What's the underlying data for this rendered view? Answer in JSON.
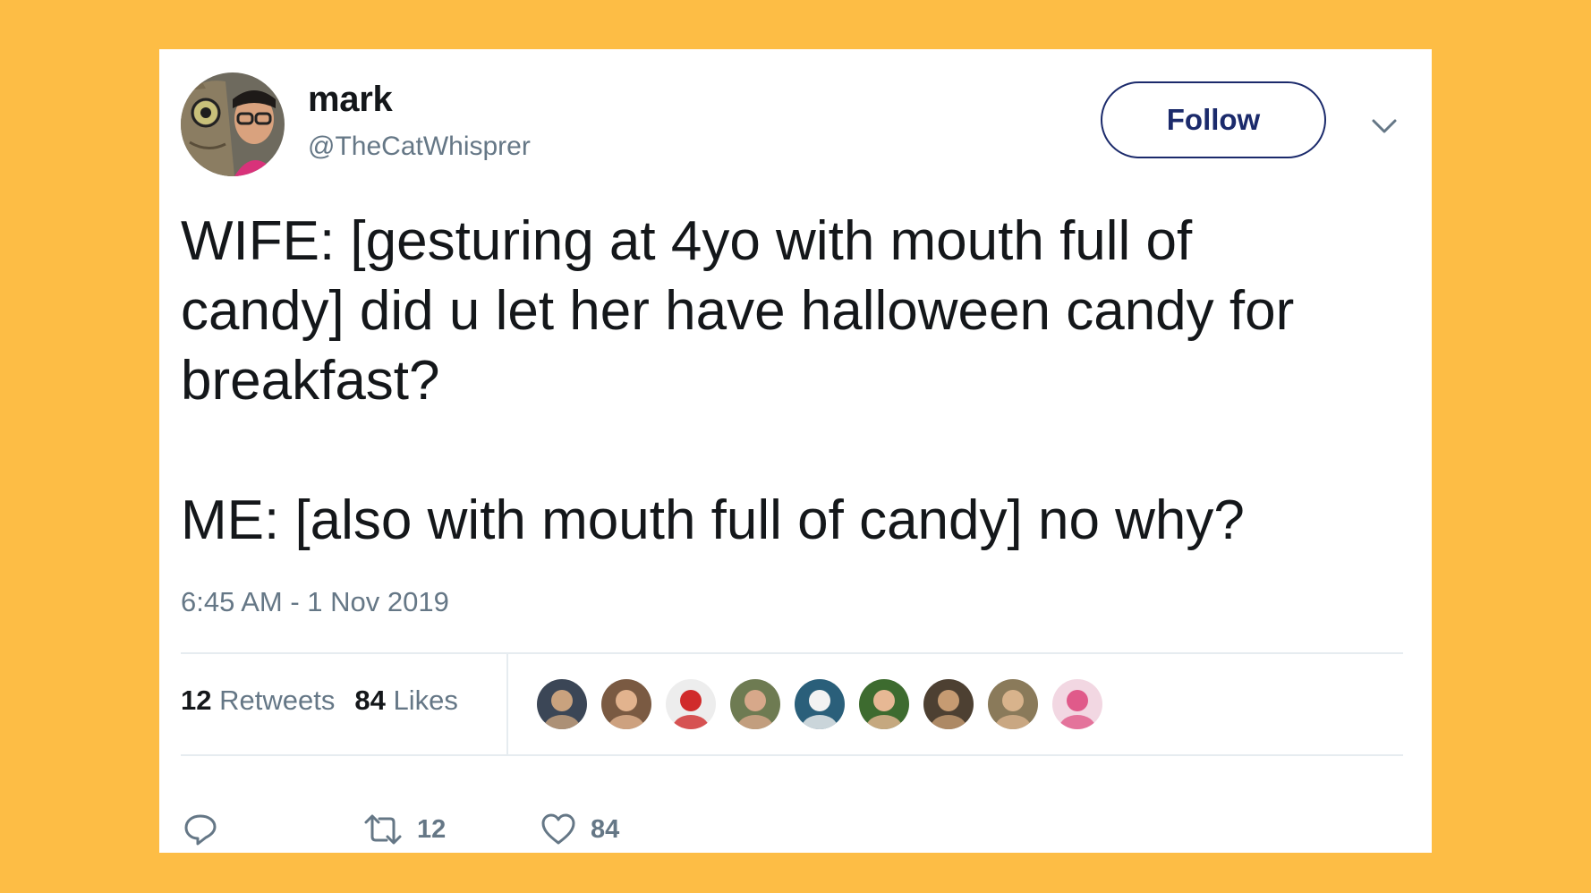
{
  "user": {
    "name": "mark",
    "handle": "@TheCatWhisprer"
  },
  "follow_label": "Follow",
  "tweet": {
    "lines": [
      "WIFE: [gesturing at 4yo with mouth full of",
      "candy] did u let her have halloween candy for",
      "breakfast?",
      "ME: [also with mouth full of candy] no why?"
    ],
    "timestamp": "6:45 AM - 1 Nov 2019"
  },
  "stats": {
    "retweets_count": "12",
    "retweets_label": "Retweets",
    "likes_count": "84",
    "likes_label": "Likes"
  },
  "liker_avatars": [
    {
      "name": "liker-avatar-1",
      "bg": "#3B4656",
      "fg": "#C9A27E"
    },
    {
      "name": "liker-avatar-2",
      "bg": "#7A5A42",
      "fg": "#E2B38E"
    },
    {
      "name": "liker-avatar-3",
      "bg": "#EDEDED",
      "fg": "#D02B2B"
    },
    {
      "name": "liker-avatar-4",
      "bg": "#6E7B52",
      "fg": "#D7A88A"
    },
    {
      "name": "liker-avatar-5",
      "bg": "#2A5F7A",
      "fg": "#F2F2F2"
    },
    {
      "name": "liker-avatar-6",
      "bg": "#3D6B2F",
      "fg": "#E7B894"
    },
    {
      "name": "liker-avatar-7",
      "bg": "#4D4032",
      "fg": "#C69B72"
    },
    {
      "name": "liker-avatar-8",
      "bg": "#8A7A5A",
      "fg": "#D8B38C"
    },
    {
      "name": "liker-avatar-9",
      "bg": "#F2D7E2",
      "fg": "#E05A8A"
    }
  ],
  "actions": {
    "retweet_count": "12",
    "like_count": "84"
  },
  "colors": {
    "background": "#FDBD45",
    "card": "#FFFFFF",
    "text": "#14171A",
    "secondary_text": "#657786",
    "follow_accent": "#1B2A6B",
    "divider": "#E6ECF0"
  },
  "icons": {
    "reply": "reply-icon",
    "retweet": "retweet-icon",
    "like": "heart-icon",
    "menu": "chevron-down-icon"
  }
}
